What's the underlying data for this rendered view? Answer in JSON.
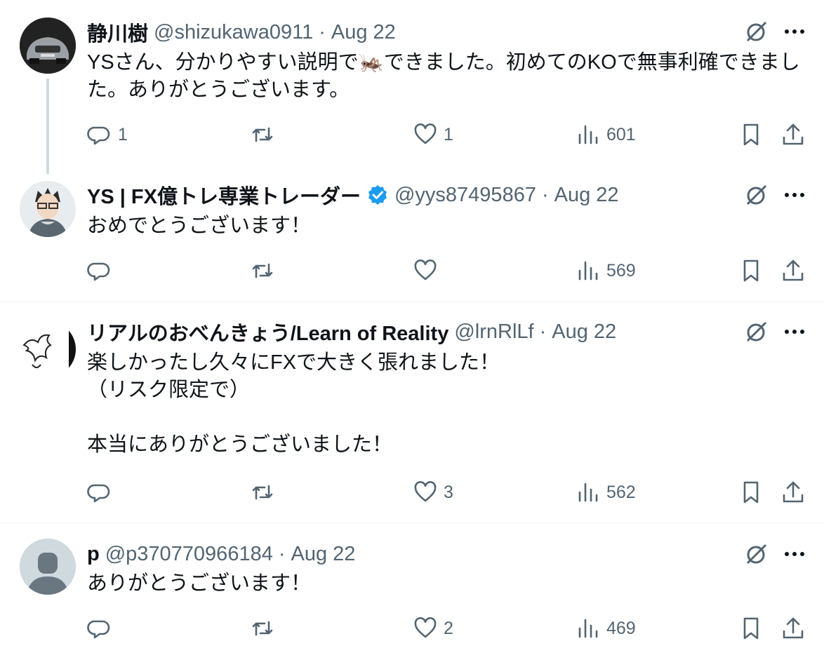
{
  "tweets": [
    {
      "name": "静川樹",
      "handle": "@shizukawa0911",
      "separator": "·",
      "date": "Aug 22",
      "text": "YSさん、分かりやすい説明で🦗できました。初めてのKOで無事利確できました。ありがとうございます。",
      "counts": {
        "reply": "1",
        "retweet": "",
        "like": "1",
        "views": "601"
      },
      "verified": false
    },
    {
      "name": "YS | FX億トレ専業トレーダー",
      "handle": "@yys87495867",
      "separator": "·",
      "date": "Aug 22",
      "text": "おめでとうございます！",
      "counts": {
        "reply": "",
        "retweet": "",
        "like": "",
        "views": "569"
      },
      "verified": true
    },
    {
      "name": "リアルのおべんきょう/Learn of Reality",
      "handle": "@lrnRlLf",
      "separator": "·",
      "date": "Aug 22",
      "text": "楽しかったし久々にFXで大きく張れました！\n（リスク限定で）\n\n本当にありがとうございました！",
      "counts": {
        "reply": "",
        "retweet": "",
        "like": "3",
        "views": "562"
      },
      "verified": false
    },
    {
      "name": "p",
      "handle": "@p370770966184",
      "separator": "·",
      "date": "Aug 22",
      "text": "ありがとうございます！",
      "counts": {
        "reply": "",
        "retweet": "",
        "like": "2",
        "views": "469"
      },
      "verified": false
    }
  ],
  "colors": {
    "text": "#0f1419",
    "secondary": "#536471",
    "verified": "#1d9bf0",
    "divider": "#eff3f4",
    "thread_line": "#cfd9de"
  },
  "icons": {
    "reply": "reply-icon",
    "retweet": "retweet-icon",
    "like": "like-icon",
    "views": "views-icon",
    "bookmark": "bookmark-icon",
    "share": "share-icon",
    "grok": "grok-icon",
    "more": "more-icon"
  }
}
